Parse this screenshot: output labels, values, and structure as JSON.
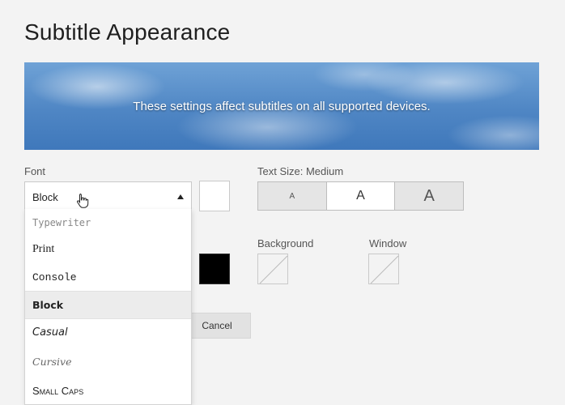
{
  "page": {
    "title": "Subtitle Appearance",
    "banner_text": "These settings affect subtitles on all supported devices."
  },
  "font": {
    "label": "Font",
    "selected": "Block",
    "options": [
      "Typewriter",
      "Print",
      "Console",
      "Block",
      "Casual",
      "Cursive",
      "Small Caps"
    ]
  },
  "text_size": {
    "label": "Text Size: Medium",
    "options": [
      "A",
      "A",
      "A"
    ],
    "selected_index": 1
  },
  "background": {
    "label": "Background"
  },
  "window": {
    "label": "Window"
  },
  "swatches": {
    "font_color": "#ffffff",
    "shadow_color": "#000000"
  },
  "actions": {
    "cancel_label": "Cancel"
  },
  "icons": {
    "dropdown_caret": "caret-up-icon",
    "pointer": "hand-pointer-icon",
    "empty_color": "none-color-icon"
  }
}
